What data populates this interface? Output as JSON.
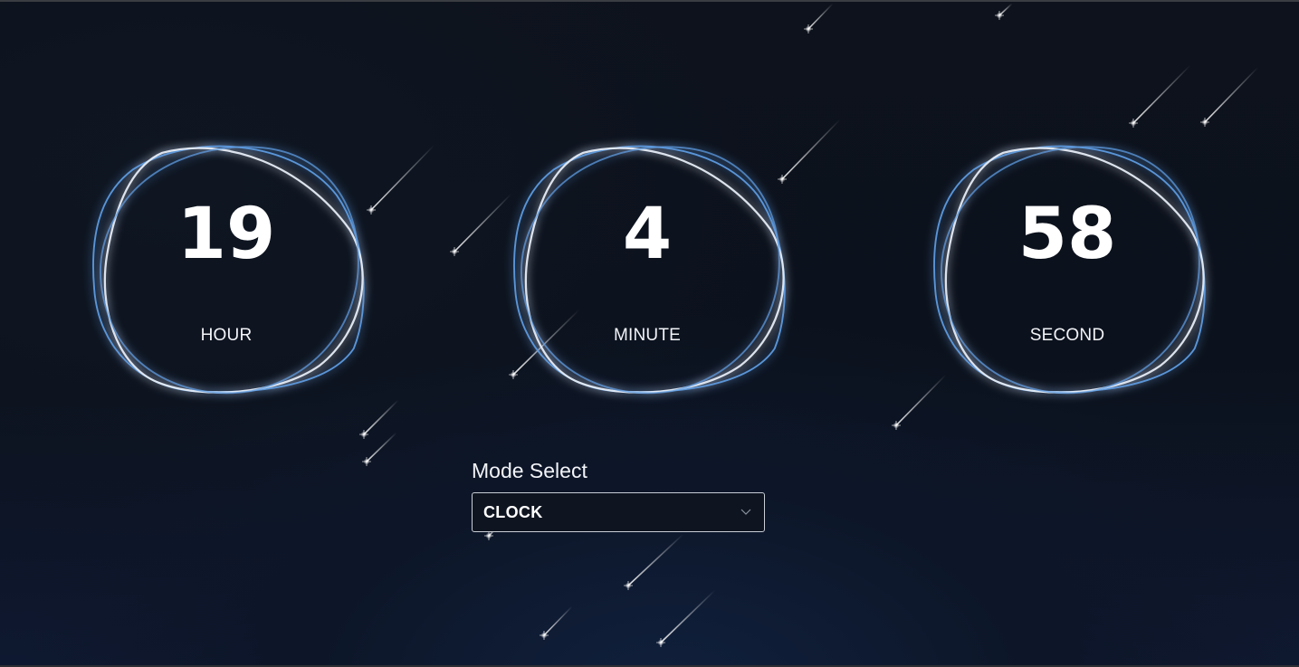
{
  "dials": [
    {
      "value": "19",
      "label": "HOUR"
    },
    {
      "value": "4",
      "label": "MINUTE"
    },
    {
      "value": "58",
      "label": "SECOND"
    }
  ],
  "mode_select": {
    "title": "Mode Select",
    "selected": "CLOCK",
    "icon": "chevron-down-icon"
  },
  "colors": {
    "background": "#0c111b",
    "ring_glow": "#4f8fd8",
    "ring_highlight": "#e8eef8",
    "text": "#ffffff"
  }
}
